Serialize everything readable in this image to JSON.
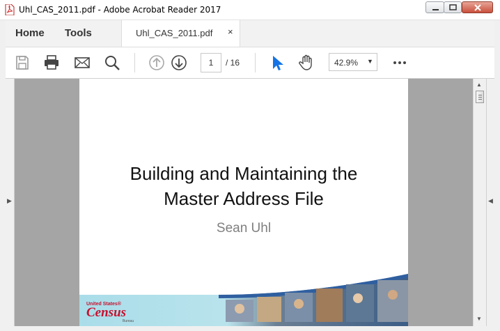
{
  "window": {
    "title": "Uhl_CAS_2011.pdf - Adobe Acrobat Reader 2017",
    "controls": {
      "minimize": "minimize-icon",
      "maximize": "maximize-icon",
      "close": "close-icon"
    }
  },
  "menu": {
    "home": "Home",
    "tools": "Tools",
    "tab_label": "Uhl_CAS_2011.pdf",
    "tab_close": "×"
  },
  "toolbar": {
    "icons": [
      "save-icon",
      "print-icon",
      "email-icon",
      "search-icon",
      "page-up-icon",
      "page-down-icon",
      "select-cursor-icon",
      "hand-tool-icon",
      "more-icon"
    ],
    "current_page": "1",
    "total_pages": "/ 16",
    "zoom": "42.9%",
    "accent_color": "#1473e6"
  },
  "document": {
    "title_line1": "Building and Maintaining the",
    "title_line2": "Master Address File",
    "author": "Sean Uhl",
    "logo": {
      "top": "United States®",
      "word": "Census",
      "bottom": "Bureau"
    }
  }
}
